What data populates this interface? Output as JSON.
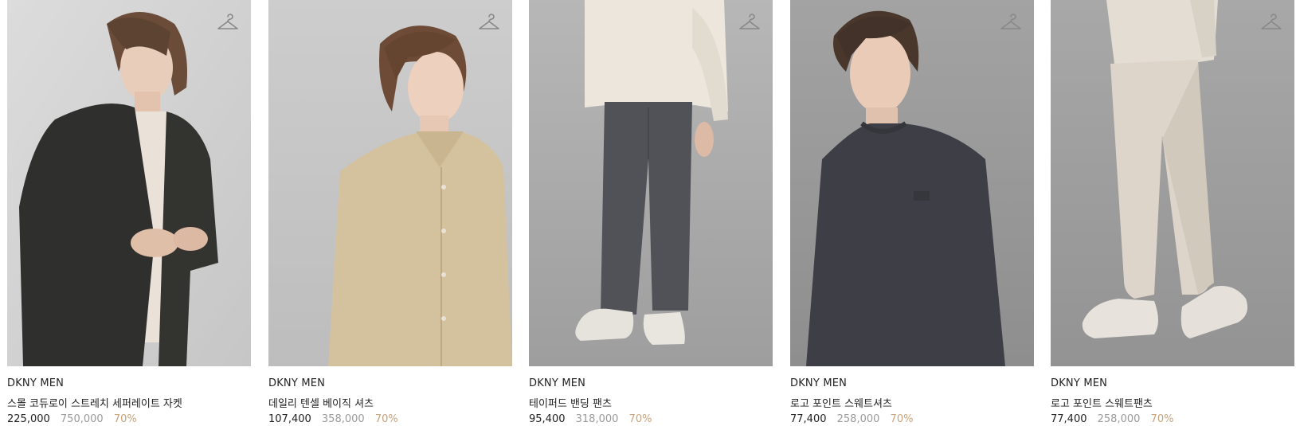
{
  "products": [
    {
      "brand": "DKNY MEN",
      "name": "스몰 코듀로이 스트레치 세퍼레이트 자켓",
      "price": "225,000",
      "original_price": "750,000",
      "discount": "70%",
      "wishlist_icon": "hanger-icon"
    },
    {
      "brand": "DKNY MEN",
      "name": "데일리 텐셀 베이직 셔츠",
      "price": "107,400",
      "original_price": "358,000",
      "discount": "70%",
      "wishlist_icon": "hanger-icon"
    },
    {
      "brand": "DKNY MEN",
      "name": "테이퍼드 밴딩 팬츠",
      "price": "95,400",
      "original_price": "318,000",
      "discount": "70%",
      "wishlist_icon": "hanger-icon"
    },
    {
      "brand": "DKNY MEN",
      "name": "로고 포인트 스웨트셔츠",
      "price": "77,400",
      "original_price": "258,000",
      "discount": "70%",
      "wishlist_icon": "hanger-icon"
    },
    {
      "brand": "DKNY MEN",
      "name": "로고 포인트 스웨트팬츠",
      "price": "77,400",
      "original_price": "258,000",
      "discount": "70%",
      "wishlist_icon": "hanger-icon"
    }
  ],
  "colors": {
    "text": "#222222",
    "original_price": "#9a9a9a",
    "discount": "#c7a27a",
    "background": "#ffffff"
  }
}
